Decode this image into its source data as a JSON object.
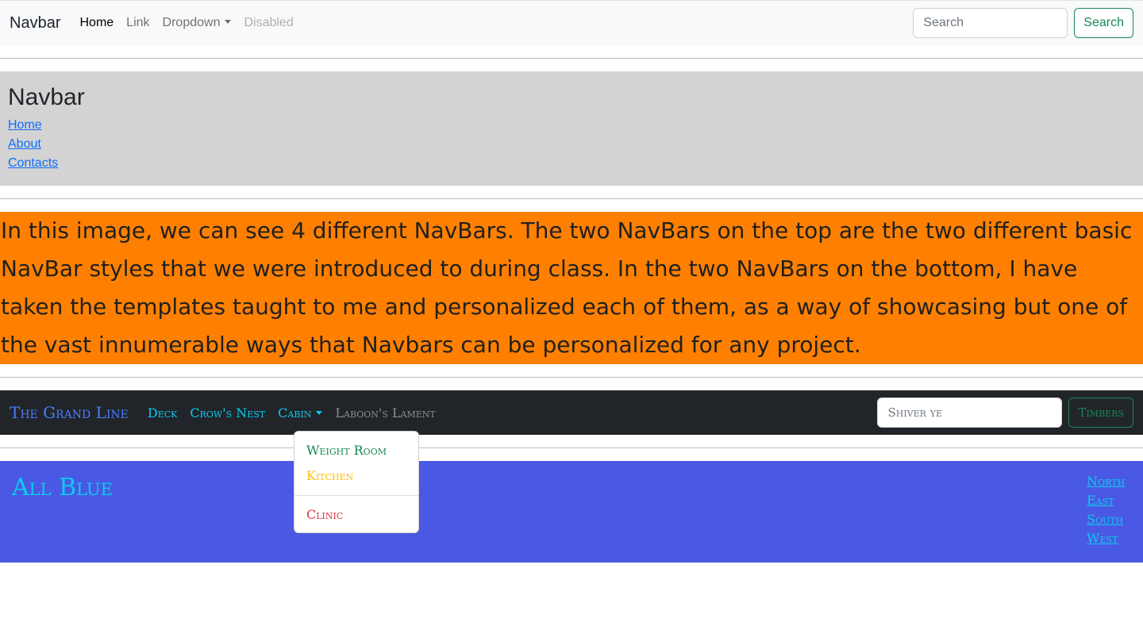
{
  "navbar1": {
    "brand": "Navbar",
    "links": [
      "Home",
      "Link",
      "Dropdown",
      "Disabled"
    ],
    "search_placeholder": "Search",
    "search_button": "Search"
  },
  "navbar2": {
    "title": "Navbar",
    "links": [
      "Home",
      "About",
      "Contacts"
    ]
  },
  "description": "In this image, we can see 4 different NavBars. The two NavBars on the top are the two different basic NavBar styles that we were introduced to during class. In the two NavBars on the bottom, I have taken the templates taught to me and personalized each of them, as a way of showcasing but one of the vast innumerable ways that Navbars can be personalized for any project.",
  "navbar3": {
    "brand": "The Grand Line",
    "links": [
      "Deck",
      "Crow's Nest",
      "Cabin",
      "Laboon's Lament"
    ],
    "search_placeholder": "Shiver ye",
    "search_button": "Timbers",
    "dropdown": {
      "items": [
        "Weight Room",
        "Kitchen",
        "Clinic"
      ],
      "colors": [
        "#198754",
        "#ffc107",
        "#dc3545"
      ]
    }
  },
  "navbar4": {
    "title": "All Blue",
    "links": [
      "North",
      "East",
      "South",
      "West"
    ]
  },
  "colors": {
    "description_bg": "#ff8000",
    "dark_nav_bg": "#212529",
    "blue_nav_bg": "#4a59e3",
    "gray_nav_bg": "#d3d3d3"
  }
}
